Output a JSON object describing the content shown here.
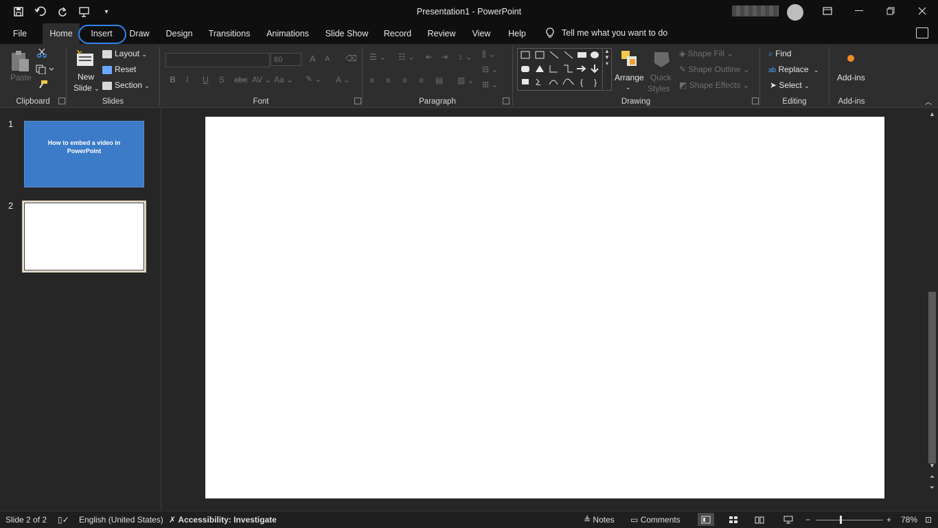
{
  "titlebar": {
    "title": "Presentation1  -  PowerPoint"
  },
  "tabs": [
    {
      "label": "File"
    },
    {
      "label": "Home"
    },
    {
      "label": "Insert"
    },
    {
      "label": "Draw"
    },
    {
      "label": "Design"
    },
    {
      "label": "Transitions"
    },
    {
      "label": "Animations"
    },
    {
      "label": "Slide Show"
    },
    {
      "label": "Record"
    },
    {
      "label": "Review"
    },
    {
      "label": "View"
    },
    {
      "label": "Help"
    }
  ],
  "tellme": "Tell me what you want to do",
  "ribbon": {
    "clipboard": {
      "label": "Clipboard",
      "paste": "Paste"
    },
    "slides": {
      "label": "Slides",
      "new_slide_line1": "New",
      "new_slide_line2": "Slide",
      "layout": "Layout",
      "reset": "Reset",
      "section": "Section"
    },
    "font": {
      "label": "Font",
      "size": "60",
      "bold": "B",
      "italic": "I",
      "underline": "U",
      "strike": "S",
      "grow": "A",
      "shrink": "A",
      "color": "A"
    },
    "paragraph": {
      "label": "Paragraph"
    },
    "drawing": {
      "label": "Drawing",
      "arrange": "Arrange",
      "quick_styles_line1": "Quick",
      "quick_styles_line2": "Styles",
      "shape_fill": "Shape Fill",
      "shape_outline": "Shape Outline",
      "shape_effects": "Shape Effects"
    },
    "editing": {
      "label": "Editing",
      "find": "Find",
      "replace": "Replace",
      "select": "Select"
    },
    "addins": {
      "label": "Add-ins",
      "button": "Add-ins"
    }
  },
  "thumbnails": [
    {
      "number": "1",
      "text": "How to embed a video in PowerPoint"
    },
    {
      "number": "2",
      "text": ""
    }
  ],
  "statusbar": {
    "slide_info": "Slide 2 of 2",
    "language": "English (United States)",
    "accessibility": "Accessibility: Investigate",
    "notes": "Notes",
    "comments": "Comments",
    "zoom": "78%",
    "minus": "−",
    "plus": "+"
  },
  "colors": {
    "accent": "#2f86f2",
    "slide1_bg": "#3b7bc7"
  }
}
